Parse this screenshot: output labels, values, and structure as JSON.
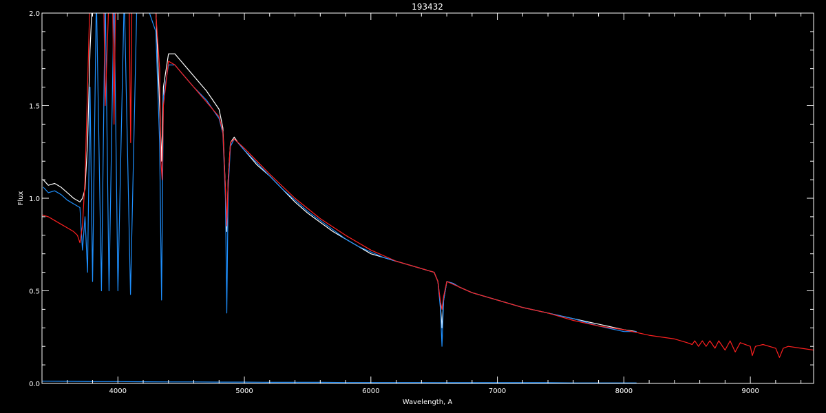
{
  "chart_data": {
    "type": "line",
    "title": "193432",
    "xlabel": "Wavelength, A",
    "ylabel": "Flux",
    "xlim": [
      3400,
      9500
    ],
    "ylim": [
      0.0,
      2.0
    ],
    "x_ticks": [
      4000,
      5000,
      6000,
      7000,
      8000,
      9000
    ],
    "y_ticks": [
      0.0,
      0.5,
      1.0,
      1.5,
      2.0
    ],
    "x_tick_labels": [
      "4000",
      "5000",
      "6000",
      "7000",
      "8000",
      "9000"
    ],
    "y_tick_labels": [
      "0.0",
      "0.5",
      "1.0",
      "1.5",
      "2.0"
    ],
    "grid": false,
    "background": "#000000",
    "axis_color": "#ffffff",
    "series": [
      {
        "color": "#ffffff",
        "x": [
          3410,
          3450,
          3500,
          3550,
          3600,
          3650,
          3700,
          3720,
          3740,
          3760,
          3780,
          3800,
          3830,
          3870,
          3900,
          3930,
          3970,
          4000,
          4050,
          4100,
          4150,
          4200,
          4250,
          4300,
          4330,
          4345,
          4360,
          4400,
          4450,
          4500,
          4550,
          4600,
          4700,
          4750,
          4800,
          4830,
          4850,
          4861,
          4872,
          4890,
          4920,
          4950,
          5000,
          5100,
          5200,
          5300,
          5400,
          5500,
          5600,
          5700,
          5800,
          5900,
          6000,
          6100,
          6200,
          6300,
          6400,
          6450,
          6500,
          6530,
          6550,
          6562,
          6575,
          6600,
          6650,
          6700,
          6800,
          6900,
          7000,
          7200,
          7400,
          7600,
          7800,
          8000,
          8100
        ],
        "values": [
          1.1,
          1.07,
          1.08,
          1.06,
          1.03,
          1.0,
          0.98,
          1.0,
          1.05,
          1.3,
          1.8,
          2.1,
          2.2,
          2.2,
          2.2,
          2.2,
          2.2,
          2.2,
          2.2,
          2.1,
          2.15,
          2.15,
          2.1,
          2.02,
          1.5,
          1.2,
          1.6,
          1.78,
          1.78,
          1.74,
          1.7,
          1.66,
          1.58,
          1.53,
          1.48,
          1.38,
          1.05,
          0.82,
          1.1,
          1.3,
          1.33,
          1.3,
          1.26,
          1.18,
          1.12,
          1.05,
          0.98,
          0.92,
          0.87,
          0.82,
          0.78,
          0.74,
          0.7,
          0.68,
          0.66,
          0.64,
          0.62,
          0.61,
          0.6,
          0.55,
          0.42,
          0.3,
          0.45,
          0.55,
          0.54,
          0.52,
          0.49,
          0.47,
          0.45,
          0.41,
          0.38,
          0.35,
          0.32,
          0.29,
          0.28
        ]
      },
      {
        "color": "#1e90ff",
        "x": [
          3410,
          3450,
          3500,
          3550,
          3600,
          3650,
          3700,
          3720,
          3740,
          3760,
          3780,
          3800,
          3830,
          3870,
          3900,
          3930,
          3970,
          4000,
          4050,
          4100,
          4150,
          4200,
          4250,
          4300,
          4330,
          4345,
          4360,
          4400,
          4450,
          4500,
          4550,
          4600,
          4700,
          4750,
          4800,
          4830,
          4850,
          4861,
          4872,
          4890,
          4920,
          4950,
          5000,
          5100,
          5200,
          5300,
          5400,
          5500,
          5600,
          5700,
          5800,
          5900,
          6000,
          6100,
          6200,
          6300,
          6400,
          6450,
          6500,
          6530,
          6550,
          6562,
          6575,
          6600,
          6650,
          6700,
          6800,
          6900,
          7000,
          7200,
          7400,
          7600,
          7800,
          8000,
          8100
        ],
        "values": [
          1.06,
          1.03,
          1.04,
          1.02,
          0.99,
          0.97,
          0.95,
          0.72,
          0.9,
          0.6,
          1.6,
          0.55,
          2.1,
          0.5,
          2.1,
          0.5,
          2.1,
          0.5,
          2.1,
          0.48,
          2.05,
          2.05,
          2.0,
          1.9,
          1.3,
          0.45,
          1.55,
          1.72,
          1.72,
          1.68,
          1.64,
          1.6,
          1.53,
          1.48,
          1.43,
          1.35,
          1.0,
          0.38,
          1.05,
          1.28,
          1.32,
          1.3,
          1.26,
          1.19,
          1.12,
          1.05,
          0.99,
          0.93,
          0.88,
          0.83,
          0.78,
          0.74,
          0.71,
          0.68,
          0.66,
          0.64,
          0.62,
          0.61,
          0.6,
          0.55,
          0.4,
          0.2,
          0.45,
          0.55,
          0.54,
          0.52,
          0.49,
          0.47,
          0.45,
          0.41,
          0.38,
          0.35,
          0.31,
          0.28,
          0.28
        ]
      },
      {
        "color": "#ff2020",
        "x": [
          3400,
          3450,
          3500,
          3550,
          3600,
          3650,
          3680,
          3700,
          3720,
          3740,
          3760,
          3780,
          3800,
          3830,
          3870,
          3890,
          3900,
          3930,
          3960,
          3970,
          3980,
          4000,
          4050,
          4090,
          4101,
          4110,
          4150,
          4200,
          4250,
          4300,
          4330,
          4340,
          4350,
          4360,
          4400,
          4450,
          4500,
          4600,
          4700,
          4800,
          4830,
          4850,
          4861,
          4872,
          4890,
          4920,
          5000,
          5200,
          5400,
          5600,
          5800,
          6000,
          6200,
          6400,
          6500,
          6530,
          6550,
          6562,
          6575,
          6600,
          6700,
          6800,
          7000,
          7200,
          7400,
          7600,
          7800,
          8000,
          8200,
          8400,
          8500,
          8540,
          8560,
          8590,
          8620,
          8650,
          8680,
          8720,
          8750,
          8800,
          8840,
          8880,
          8920,
          9000,
          9015,
          9040,
          9100,
          9200,
          9230,
          9260,
          9300,
          9400,
          9500
        ],
        "values": [
          0.91,
          0.9,
          0.88,
          0.86,
          0.84,
          0.82,
          0.8,
          0.76,
          0.85,
          1.1,
          1.6,
          2.1,
          2.1,
          2.1,
          2.1,
          2.0,
          1.5,
          2.1,
          2.0,
          1.4,
          2.0,
          2.1,
          2.1,
          2.0,
          1.3,
          2.0,
          2.1,
          2.1,
          2.05,
          2.0,
          1.7,
          1.2,
          1.1,
          1.5,
          1.74,
          1.72,
          1.68,
          1.6,
          1.52,
          1.44,
          1.36,
          1.05,
          0.85,
          1.1,
          1.3,
          1.32,
          1.27,
          1.13,
          1.0,
          0.89,
          0.8,
          0.72,
          0.66,
          0.62,
          0.6,
          0.55,
          0.44,
          0.4,
          0.47,
          0.55,
          0.52,
          0.49,
          0.45,
          0.41,
          0.38,
          0.34,
          0.31,
          0.29,
          0.26,
          0.24,
          0.22,
          0.21,
          0.23,
          0.2,
          0.23,
          0.2,
          0.23,
          0.19,
          0.23,
          0.18,
          0.23,
          0.17,
          0.22,
          0.2,
          0.15,
          0.2,
          0.21,
          0.19,
          0.14,
          0.19,
          0.2,
          0.19,
          0.18
        ]
      },
      {
        "color": "#1e90ff",
        "x": [
          3400,
          3600,
          3800,
          4000,
          4200,
          4400,
          4600,
          4800,
          5000,
          5200,
          5400,
          5600,
          5800,
          6000,
          6200,
          6400,
          6600,
          6800,
          7000,
          7200,
          7400,
          7600,
          7800,
          8000,
          8100
        ],
        "values": [
          0.012,
          0.011,
          0.01,
          0.01,
          0.009,
          0.008,
          0.008,
          0.007,
          0.007,
          0.006,
          0.006,
          0.006,
          0.005,
          0.005,
          0.005,
          0.005,
          0.004,
          0.004,
          0.004,
          0.004,
          0.004,
          0.003,
          0.003,
          0.003,
          0.003
        ]
      }
    ]
  }
}
